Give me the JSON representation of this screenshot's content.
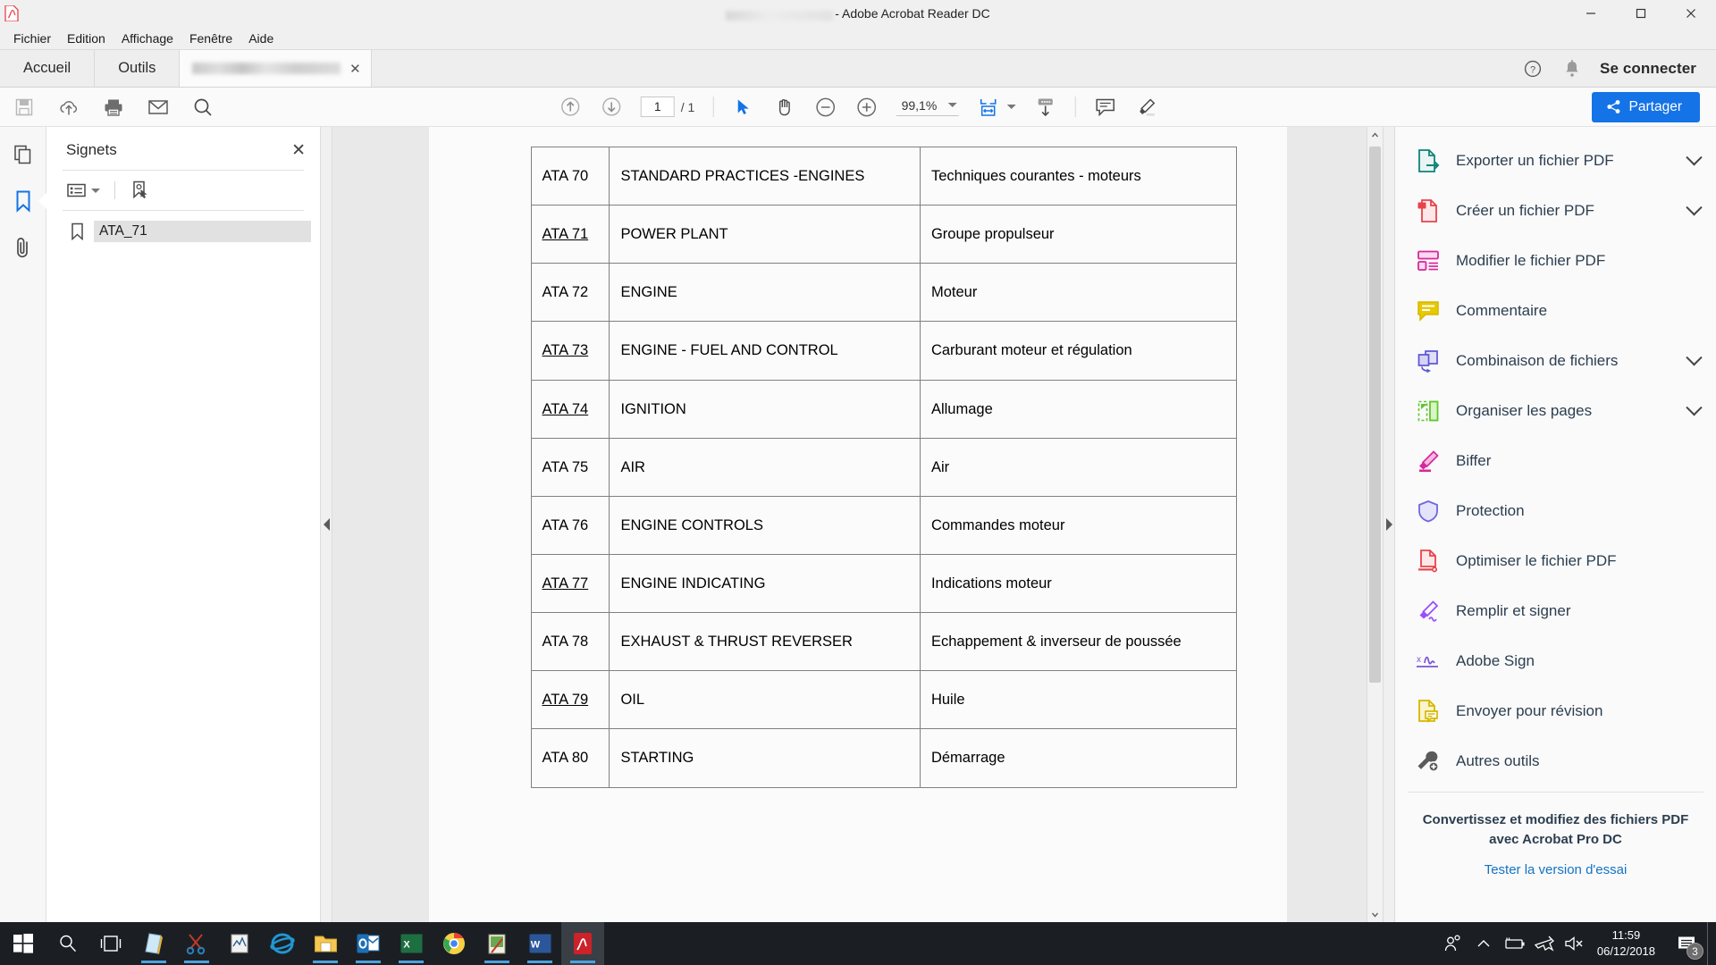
{
  "window": {
    "app_title_suffix": "- Adobe Acrobat Reader DC",
    "minimize": "–",
    "maximize": "☐",
    "close": "✕"
  },
  "menubar": {
    "items": [
      "Fichier",
      "Edition",
      "Affichage",
      "Fenêtre",
      "Aide"
    ]
  },
  "tabstrip": {
    "home_label": "Accueil",
    "tools_label": "Outils",
    "doc_tab_close": "✕",
    "signin_label": "Se connecter"
  },
  "toolbar": {
    "page_current": "1",
    "page_total": "/ 1",
    "zoom_value": "99,1%",
    "share_label": "Partager"
  },
  "bookmarks": {
    "panel_title": "Signets",
    "close_label": "✕",
    "items": [
      {
        "label": "ATA_71"
      }
    ]
  },
  "document": {
    "columns": [
      "code",
      "english",
      "french"
    ],
    "rows": [
      {
        "code": "ATA 70",
        "code_link": false,
        "english": "STANDARD PRACTICES -ENGINES",
        "french": "Techniques courantes - moteurs"
      },
      {
        "code": "ATA 71",
        "code_link": true,
        "english": "POWER PLANT",
        "french": "Groupe propulseur"
      },
      {
        "code": "ATA 72",
        "code_link": false,
        "english": "ENGINE",
        "french": "Moteur"
      },
      {
        "code": "ATA 73",
        "code_link": true,
        "english": "ENGINE - FUEL AND CONTROL",
        "french": "Carburant moteur et régulation"
      },
      {
        "code": "ATA 74",
        "code_link": true,
        "english": "IGNITION",
        "french": "Allumage"
      },
      {
        "code": "ATA 75",
        "code_link": false,
        "english": "AIR",
        "french": "Air"
      },
      {
        "code": "ATA 76",
        "code_link": false,
        "english": "ENGINE CONTROLS",
        "french": "Commandes moteur"
      },
      {
        "code": "ATA 77",
        "code_link": true,
        "english": "ENGINE INDICATING",
        "french": "Indications moteur"
      },
      {
        "code": "ATA 78",
        "code_link": false,
        "english": "EXHAUST & THRUST REVERSER",
        "french": "Echappement & inverseur de poussée"
      },
      {
        "code": "ATA 79",
        "code_link": true,
        "english": "OIL",
        "french": "Huile"
      },
      {
        "code": "ATA 80",
        "code_link": false,
        "english": "STARTING",
        "french": "Démarrage"
      }
    ]
  },
  "tools_panel": {
    "items": [
      {
        "label": "Exporter un fichier PDF",
        "icon": "export-pdf-icon",
        "color": "#12827b",
        "chevron": true
      },
      {
        "label": "Créer un fichier PDF",
        "icon": "create-pdf-icon",
        "color": "#e8434a",
        "chevron": true
      },
      {
        "label": "Modifier le fichier PDF",
        "icon": "edit-pdf-icon",
        "color": "#d6289b",
        "chevron": false
      },
      {
        "label": "Commentaire",
        "icon": "comment-icon",
        "color": "#d6b800",
        "chevron": false
      },
      {
        "label": "Combinaison de fichiers",
        "icon": "combine-files-icon",
        "color": "#5b54d6",
        "chevron": true
      },
      {
        "label": "Organiser les pages",
        "icon": "organize-pages-icon",
        "color": "#5ec72b",
        "chevron": true
      },
      {
        "label": "Biffer",
        "icon": "redact-icon",
        "color": "#d6289b",
        "chevron": false
      },
      {
        "label": "Protection",
        "icon": "protect-icon",
        "color": "#6f66e0",
        "chevron": false
      },
      {
        "label": "Optimiser le fichier PDF",
        "icon": "optimize-pdf-icon",
        "color": "#e8434a",
        "chevron": false
      },
      {
        "label": "Remplir et signer",
        "icon": "fill-sign-icon",
        "color": "#9b4dff",
        "chevron": false
      },
      {
        "label": "Adobe Sign",
        "icon": "adobe-sign-icon",
        "color": "#7a52d6",
        "chevron": false
      },
      {
        "label": "Envoyer pour révision",
        "icon": "send-review-icon",
        "color": "#d6b800",
        "chevron": false
      },
      {
        "label": "Autres outils",
        "icon": "more-tools-icon",
        "color": "#5a5a5a",
        "chevron": false
      }
    ],
    "promo_line1": "Convertissez et modifiez des fichiers PDF",
    "promo_line2": "avec Acrobat Pro DC",
    "promo_link": "Tester la version d'essai"
  },
  "taskbar": {
    "clock_time": "11:59",
    "clock_date": "06/12/2018",
    "notification_count": "3"
  }
}
